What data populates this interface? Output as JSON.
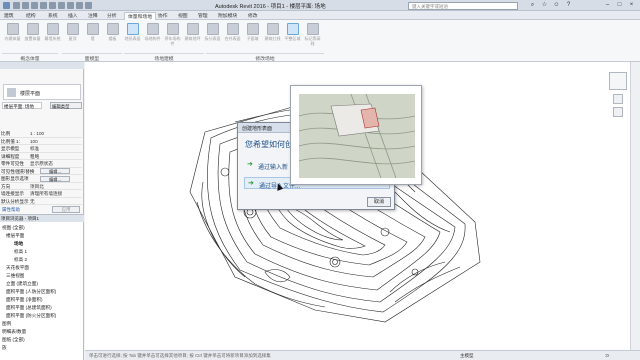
{
  "titlebar": {
    "title": "Autodesk Revit 2016 -     项目1 - 楼层平面: 场地",
    "search_placeholder": "键入关键字或短语",
    "win_min": "–",
    "win_max": "□",
    "win_close": "×"
  },
  "tabs": [
    "建筑",
    "结构",
    "系统",
    "插入",
    "注释",
    "分析",
    "体量和场地",
    "协作",
    "视图",
    "管理",
    "附加模块",
    "修改"
  ],
  "active_tab": "体量和场地",
  "ribbon": {
    "buttons": [
      "内建体量",
      "放置体量",
      "幕墙系统",
      "屋顶",
      "墙",
      "楼板",
      "地形表面",
      "场地构件",
      "停车场构件",
      "建筑地坪",
      "拆分表面",
      "合并表面",
      "子面域",
      "建筑红线",
      "平整区域",
      "标记等高线"
    ],
    "panels": [
      "概念体量",
      "面模型",
      "场地建模",
      "修改场地"
    ]
  },
  "properties": {
    "type_name": "楼层平面",
    "edit_type": "编辑类型",
    "selector": "楼层平面: 场地",
    "rows": [
      {
        "k": "比例",
        "v": "1 : 100"
      },
      {
        "k": "比例值 1:",
        "v": "100"
      },
      {
        "k": "显示模型",
        "v": "标准"
      },
      {
        "k": "详细程度",
        "v": "粗略"
      },
      {
        "k": "零件可见性",
        "v": "显示原状态"
      },
      {
        "k": "可见性/图形替换",
        "v": "编辑..."
      },
      {
        "k": "图形显示选项",
        "v": "编辑..."
      },
      {
        "k": "方向",
        "v": "项目北"
      },
      {
        "k": "墙连接显示",
        "v": "清理所有墙连接"
      },
      {
        "k": "规程",
        "v": "建筑"
      },
      {
        "k": "显示隐藏线",
        "v": "按规程"
      },
      {
        "k": "颜色方案位置",
        "v": "背景"
      },
      {
        "k": "颜色方案",
        "v": "<无>"
      },
      {
        "k": "系统颜色方案",
        "v": "编辑..."
      },
      {
        "k": "默认分析显示",
        "v": "无"
      },
      {
        "k": "日光路径",
        "v": ""
      }
    ],
    "help_link": "属性帮助",
    "apply": "应用"
  },
  "browser": {
    "title": "项目浏览器 - 项目1",
    "items": [
      "视图 (全部)",
      "楼层平面",
      "场地",
      "标高 1",
      "标高 2",
      "天花板平面",
      "三维视图",
      "立面 (建筑立面)",
      "面积平面 (人防分区面积)",
      "面积平面 (净面积)",
      "面积平面 (总建筑面积)",
      "面积平面 (防火分区面积)",
      "图例",
      "明细表/数量",
      "图纸 (全部)",
      "族"
    ]
  },
  "status": {
    "hint": "单击可进行选择; 按 Tab 键并单击可选择其他项目; 按 Ctrl 键并单击可将新项目添加到选择集",
    "model": "主模型",
    "zoom": ":0"
  },
  "dialog": {
    "title": "创建地形表面",
    "question": "您希望如何创建地形表面？",
    "option1": "通过输入新",
    "option2": "通过导入文件...",
    "cancel": "取消"
  },
  "colors": {
    "accent": "#1f4f8a",
    "ribbon_bg": "#f6f7f9",
    "titlebar": "#d7dde6",
    "arrow": "#2f9a3a"
  }
}
